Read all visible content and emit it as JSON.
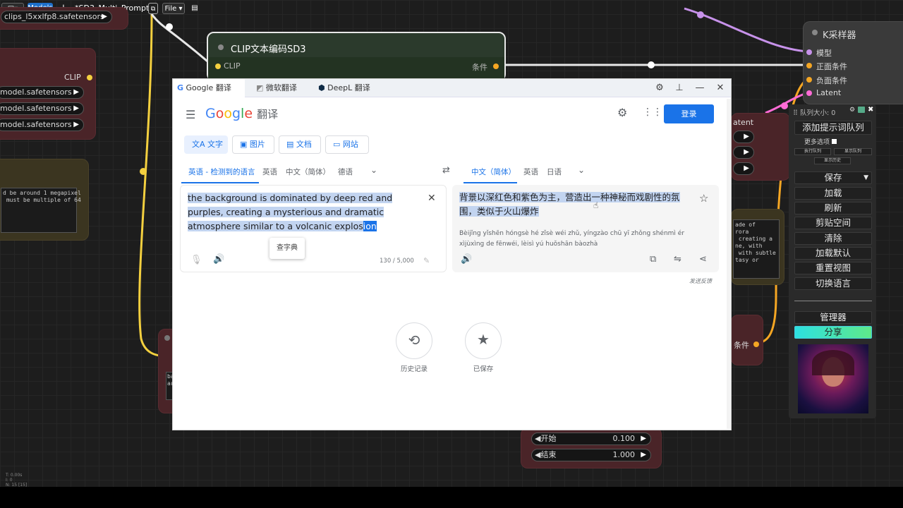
{
  "topbar": {
    "models": "Models",
    "plus": "+",
    "workflow_title": "*SD3_Multi_Prompt",
    "file_menu": "File"
  },
  "canvas": {
    "clip_loader_text": "clips_l5xxlfp8.safetensors",
    "clip_out_label": "CLIP",
    "model_items": [
      "model.safetensors",
      "model.safetensors",
      "model.safetensors"
    ],
    "note_text_1": "d be around 1 megapixel\n must be multiple of 64",
    "clip_node_title": "CLIP文本编码SD3",
    "clip_input": "CLIP",
    "cond_output": "条件",
    "ksampler_title": "K采样器",
    "ksampler_inputs": [
      "模型",
      "正面条件",
      "负面条件",
      "Latent"
    ],
    "latent_label": "atent",
    "note_text_2": "ade of\nrora\n creating a\nne, with\n with subtle\ntasy or",
    "cond_label_2": "条件",
    "note_text_3": "ba\nar",
    "start_label": "开始",
    "start_value": "0.100",
    "end_label": "结束",
    "end_value": "1.000",
    "stats": "T: 0.00s\nI: 0\nN: 15 [15]"
  },
  "side_panel": {
    "queue_size": "队列大小: 0",
    "add_prompt_queue": "添加提示词队列",
    "more_options": "更多选项",
    "small_buttons": [
      "执行队列",
      "显示队列",
      "显示历史"
    ],
    "save": "保存",
    "load": "加载",
    "refresh": "刷新",
    "clipspace": "剪贴空间",
    "clear": "清除",
    "load_default": "加载默认",
    "reset_view": "重置视图",
    "switch_lang": "切换语言",
    "manager": "管理器",
    "share": "分享"
  },
  "translator": {
    "tabs": [
      "Google 翻译",
      "微软翻译",
      "DeepL 翻译"
    ],
    "logo_letters": [
      "G",
      "o",
      "o",
      "g",
      "l",
      "e"
    ],
    "logo_colors": [
      "#4285f4",
      "#ea4335",
      "#fbbc05",
      "#4285f4",
      "#34a853",
      "#ea4335"
    ],
    "logo_suffix": "翻译",
    "login": "登录",
    "modes": [
      "文字",
      "图片",
      "文档",
      "网站"
    ],
    "src_langs": [
      "英语 - 检测到的语言",
      "英语",
      "中文（简体）",
      "德语"
    ],
    "tgt_langs": [
      "中文（简体）",
      "英语",
      "日语"
    ],
    "source_before": "the background is dominated by deep red and purples, creating a mysterious and dramatic atmosphere similar to a volcanic explos",
    "source_selected": "ion",
    "tooltip": "查字典",
    "char_count": "130 / 5,000",
    "target_text": "背景以深红色和紫色为主，营造出一种神秘而戏剧性的氛围，类似于火山爆炸",
    "pinyin": "Bèijǐng yǐshēn hóngsè hé zǐsè wéi zhǔ, yíngzào chū yī zhǒng shénmì ér xìjùxìng de fēnwéi, lèisì yú huǒshān bàozhà",
    "feedback": "发送反馈",
    "history": "历史记录",
    "saved": "已保存"
  },
  "colors": {
    "accent_blue": "#1a73e8",
    "wire_yellow": "#f4d03f",
    "wire_purple": "#c792ea",
    "wire_orange": "#f5a623",
    "wire_pink": "#ff6bd6",
    "share_gradient": "#2de0e0"
  }
}
